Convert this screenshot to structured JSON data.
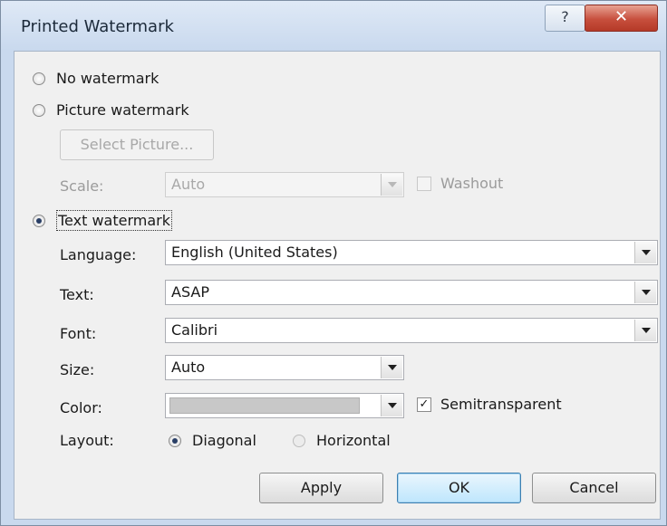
{
  "dialog": {
    "title": "Printed Watermark",
    "help_glyph": "?",
    "close_glyph": "✕"
  },
  "options": {
    "no_watermark": "No watermark",
    "picture_watermark": "Picture watermark",
    "text_watermark": "Text watermark",
    "selected": "text_watermark"
  },
  "picture": {
    "select_button": "Select Picture...",
    "scale_label": "Scale:",
    "scale_value": "Auto",
    "washout_label": "Washout"
  },
  "text_options": {
    "language_label": "Language:",
    "language_value": "English (United States)",
    "text_label": "Text:",
    "text_value": "ASAP",
    "font_label": "Font:",
    "font_value": "Calibri",
    "size_label": "Size:",
    "size_value": "Auto",
    "color_label": "Color:",
    "color_value": "#c8c8c8",
    "semitransparent_label": "Semitransparent",
    "semitransparent_checked": true,
    "layout_label": "Layout:",
    "layout_diagonal": "Diagonal",
    "layout_horizontal": "Horizontal",
    "layout_selected": "diagonal"
  },
  "buttons": {
    "apply": "Apply",
    "ok": "OK",
    "cancel": "Cancel"
  },
  "icons": {
    "help": "help-icon",
    "close": "close-icon",
    "dropdown": "chevron-down-icon",
    "check": "check-icon"
  }
}
